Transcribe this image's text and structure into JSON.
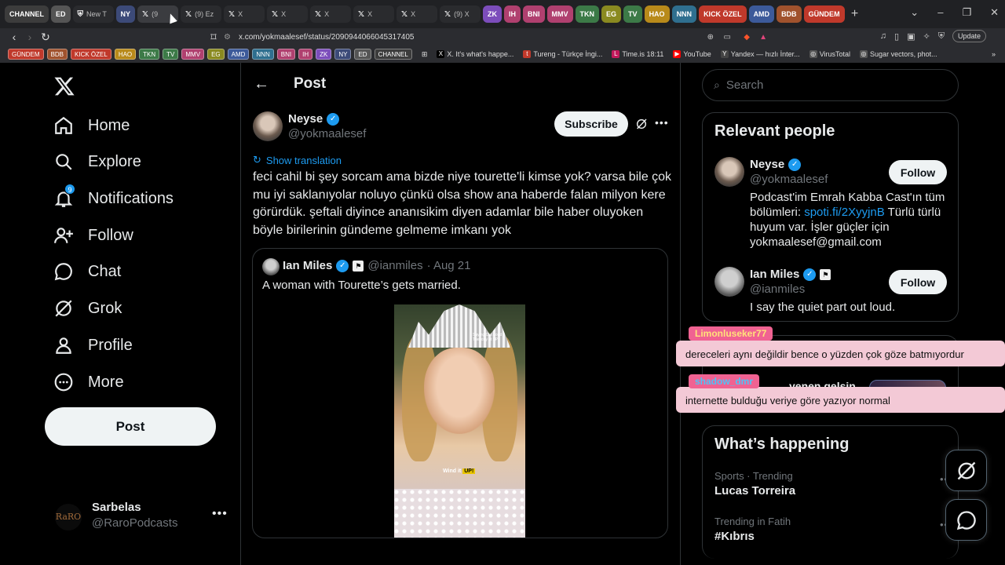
{
  "browser": {
    "tabs": [
      {
        "label": "CHANNEL",
        "color": "#3c3c3c"
      },
      {
        "label": "ED",
        "color": "#555555"
      },
      {
        "label": "New T",
        "color": "#2a2b2e"
      },
      {
        "label": "NY",
        "color": "#3c4a78"
      },
      {
        "label": "(9",
        "color": "#3b3c40"
      },
      {
        "label": "(9) Ez",
        "color": "#2a2b2e"
      },
      {
        "label": "X",
        "color": "#2a2b2e"
      },
      {
        "label": "X",
        "color": "#2a2b2e"
      },
      {
        "label": "X",
        "color": "#2a2b2e"
      },
      {
        "label": "X",
        "color": "#2a2b2e"
      },
      {
        "label": "X",
        "color": "#2a2b2e"
      },
      {
        "label": "(9) X",
        "color": "#2a2b2e"
      },
      {
        "label": "ZK",
        "color": "#7c4dbb"
      },
      {
        "label": "IH",
        "color": "#b0406f"
      },
      {
        "label": "BNI",
        "color": "#b0406f"
      },
      {
        "label": "MMV",
        "color": "#b0406f"
      },
      {
        "label": "TKN",
        "color": "#3c7a47"
      },
      {
        "label": "EG",
        "color": "#8a8a20"
      },
      {
        "label": "TV",
        "color": "#3c7a47"
      },
      {
        "label": "HAO",
        "color": "#b88a1a"
      },
      {
        "label": "NNN",
        "color": "#2f6f8f"
      },
      {
        "label": "KICK ÖZEL",
        "color": "#c0392b"
      },
      {
        "label": "AMD",
        "color": "#3c5a9a"
      },
      {
        "label": "BDB",
        "color": "#a0522d"
      },
      {
        "label": "GÜNDEM",
        "color": "#c0392b"
      }
    ],
    "url": "x.com/yokmaalesef/status/2090944066045317405",
    "update_label": "Update",
    "bookmark_folders": [
      {
        "label": "GÜNDEM",
        "color": "#c0392b"
      },
      {
        "label": "BDB",
        "color": "#a0522d"
      },
      {
        "label": "KICK ÖZEL",
        "color": "#c0392b"
      },
      {
        "label": "HAO",
        "color": "#b88a1a"
      },
      {
        "label": "TKN",
        "color": "#3c7a47"
      },
      {
        "label": "TV",
        "color": "#3c7a47"
      },
      {
        "label": "MMV",
        "color": "#b0406f"
      },
      {
        "label": "EG",
        "color": "#8a8a20"
      },
      {
        "label": "AMD",
        "color": "#3c5a9a"
      },
      {
        "label": "NNN",
        "color": "#2f6f8f"
      },
      {
        "label": "BNI",
        "color": "#b0406f"
      },
      {
        "label": "IH",
        "color": "#b0406f"
      },
      {
        "label": "ZK",
        "color": "#7c4dbb"
      },
      {
        "label": "NY",
        "color": "#3c4a78"
      },
      {
        "label": "ED",
        "color": "#555555"
      },
      {
        "label": "CHANNEL",
        "color": "#3c3c3c"
      }
    ],
    "bookmark_links": [
      {
        "label": "X. It's what's happe...",
        "fav": "X",
        "color": "#000000"
      },
      {
        "label": "Tureng - Türkçe İngi...",
        "fav": "t",
        "color": "#c0392b"
      },
      {
        "label": "Time.is 18:11",
        "fav": "L",
        "color": "#c2185b"
      },
      {
        "label": "YouTube",
        "fav": "▶",
        "color": "#ff0000"
      },
      {
        "label": "Yandex — hızlı İnter...",
        "fav": "Y",
        "color": "#444444"
      },
      {
        "label": "VirusTotal",
        "fav": "◎",
        "color": "#555555"
      },
      {
        "label": "Sugar vectors, phot...",
        "fav": "◎",
        "color": "#555555"
      }
    ]
  },
  "nav": {
    "items": [
      {
        "label": "Home",
        "icon": "home-icon"
      },
      {
        "label": "Explore",
        "icon": "search-icon"
      },
      {
        "label": "Notifications",
        "icon": "bell-icon",
        "badge": "9"
      },
      {
        "label": "Follow",
        "icon": "follow-icon"
      },
      {
        "label": "Chat",
        "icon": "chat-icon"
      },
      {
        "label": "Grok",
        "icon": "grok-icon"
      },
      {
        "label": "Profile",
        "icon": "profile-icon"
      },
      {
        "label": "More",
        "icon": "more-icon"
      }
    ],
    "post_label": "Post",
    "account": {
      "name": "Sarbelas",
      "handle": "@RaroPodcasts",
      "avatar_text": "RaRO"
    }
  },
  "main": {
    "title": "Post",
    "author": {
      "name": "Neyse",
      "handle": "@yokmaalesef"
    },
    "subscribe_label": "Subscribe",
    "show_translation": "Show translation",
    "text": "feci cahil bi şey sorcam ama bizde niye tourette'li kimse yok? varsa bile çok mu iyi saklanıyolar noluyo çünkü olsa show ana haberde falan milyon kere görürdük. şeftali diyince ananısikim diyen adamlar bile haber oluyoken böyle birilerinin gündeme gelmeme imkanı yok",
    "quote": {
      "name": "Ian Miles",
      "handle": "@ianmiles",
      "date": "· Aug 21",
      "text": "A woman with Tourette’s gets married.",
      "video_logo": "Saying Out Loud Tuesday at 9P",
      "video_caption_pre": "Wind it",
      "video_caption_hl": "UP!"
    }
  },
  "right": {
    "search_placeholder": "Search",
    "relevant_title": "Relevant people",
    "people": [
      {
        "name": "Neyse",
        "handle": "@yokmaalesef",
        "follow_label": "Follow",
        "bio_pre": "Podcast'im Emrah Kabba Cast'ın tüm bölümleri: ",
        "bio_link": "spoti.fi/2XyyjnB",
        "bio_post": " Türlü türlü huyum var. İşler güçler için yokmaalesef@gmail.com"
      },
      {
        "name": "Ian Miles",
        "handle": "@ianmiles",
        "follow_label": "Follow",
        "bio_pre": "I say the quiet part out loud.",
        "bio_link": "",
        "bio_post": ""
      }
    ],
    "partial_card_text": "yenen gelsin",
    "chat_overlays": [
      {
        "user": "Limonluseker77",
        "user_bg": "#f06292",
        "user_color": "#ffe27a",
        "message": "dereceleri aynı değildir bence o yüzden çok göze batmıyordur"
      },
      {
        "user": "shadow_dmr",
        "user_bg": "#f06292",
        "user_color": "#4fc3f7",
        "message": "internette bulduğu veriye göre yazıyor normal"
      }
    ],
    "happening_title": "What’s happening",
    "trends": [
      {
        "meta": "Sports · Trending",
        "name": "Lucas Torreira"
      },
      {
        "meta": "Trending in Fatih",
        "name": "#Kıbrıs"
      }
    ]
  }
}
